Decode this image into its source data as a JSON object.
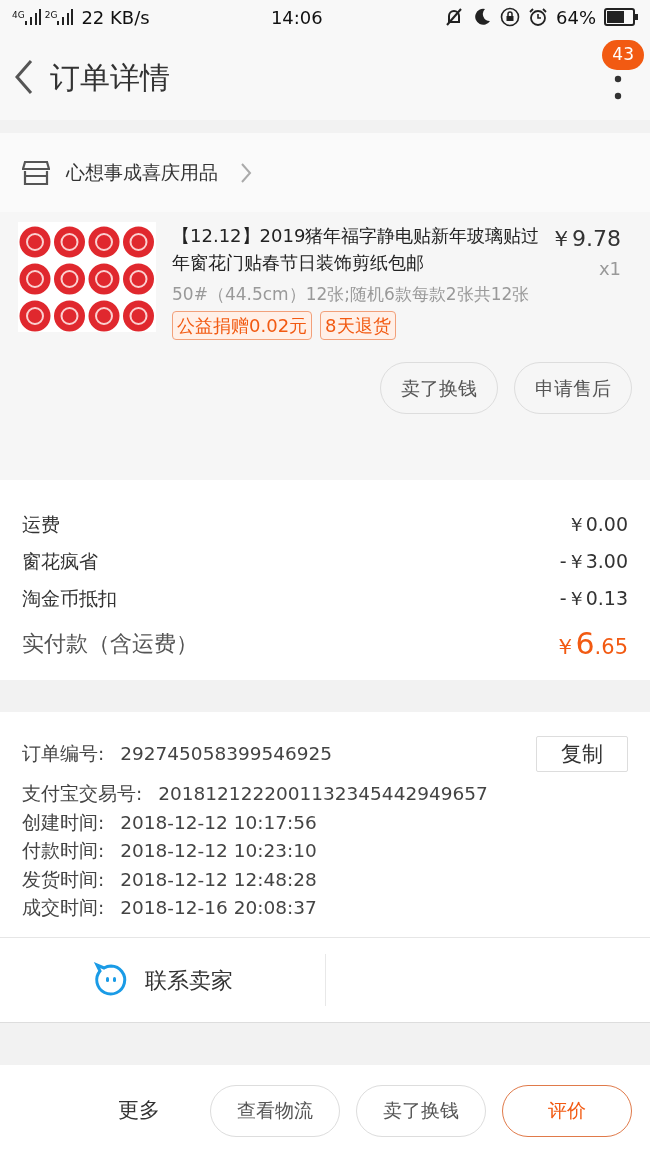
{
  "status_bar": {
    "net_labels": [
      "4G",
      "2G"
    ],
    "speed": "22 KB/s",
    "time": "14:06",
    "battery": "64%"
  },
  "header": {
    "title": "订单详情",
    "badge": "43"
  },
  "shop": {
    "name": "心想事成喜庆用品"
  },
  "item": {
    "title": "【12.12】2019猪年福字静电贴新年玻璃贴过年窗花门贴春节日装饰剪纸包邮",
    "price": "￥9.78",
    "qty": "x1",
    "spec": "50#（44.5cm）12张;随机6款每款2张共12张",
    "tags": [
      "公益捐赠0.02元",
      "8天退货"
    ],
    "actions": [
      {
        "label": "卖了换钱"
      },
      {
        "label": "申请售后"
      }
    ]
  },
  "fees": [
    {
      "label": "运费",
      "value": "￥0.00"
    },
    {
      "label": "窗花疯省",
      "value": "-￥3.00"
    },
    {
      "label": "淘金币抵扣",
      "value": "-￥0.13"
    }
  ],
  "total": {
    "label": "实付款（含运费）",
    "currency": "￥",
    "integer": "6",
    "decimal": ".65"
  },
  "info": {
    "copy_button": "复制",
    "rows": [
      {
        "label": "订单编号:",
        "value": "292745058399546925"
      },
      {
        "label": "支付宝交易号:",
        "value": "2018121222001132345442949657"
      },
      {
        "label": "创建时间:",
        "value": "2018-12-12 10:17:56"
      },
      {
        "label": "付款时间:",
        "value": "2018-12-12 10:23:10"
      },
      {
        "label": "发货时间:",
        "value": "2018-12-12 12:48:28"
      },
      {
        "label": "成交时间:",
        "value": "2018-12-16 20:08:37"
      }
    ]
  },
  "contact": {
    "label": "联系卖家"
  },
  "bottom_bar": {
    "more": "更多",
    "buttons": [
      {
        "label": "查看物流",
        "kind": "plain"
      },
      {
        "label": "卖了换钱",
        "kind": "plain"
      },
      {
        "label": "评价",
        "kind": "primary"
      }
    ]
  }
}
